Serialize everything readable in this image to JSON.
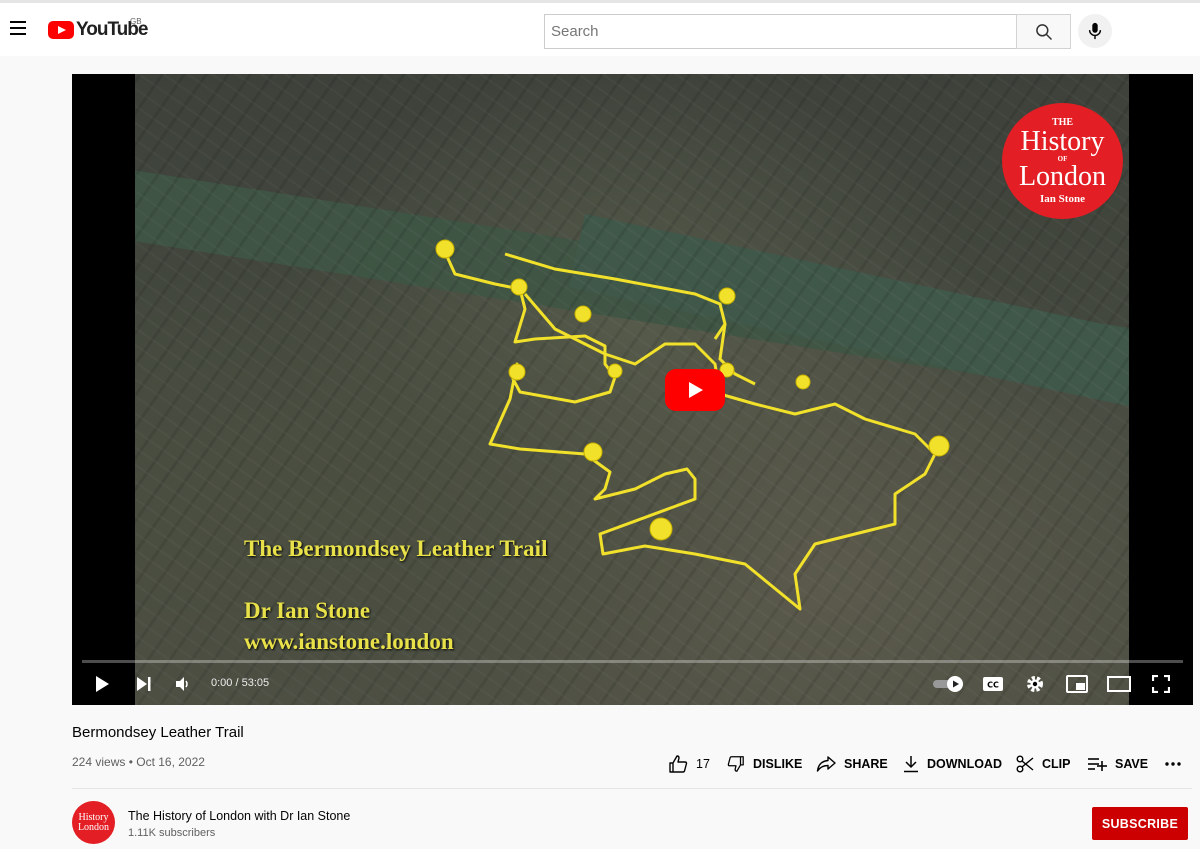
{
  "header": {
    "logo_text": "YouTube",
    "region": "GB",
    "search_placeholder": "Search"
  },
  "video": {
    "overlay_title": "The Bermondsey Leather Trail",
    "overlay_author": "Dr Ian Stone",
    "overlay_website": "www.ianstone.london",
    "badge": {
      "the": "THE",
      "history": "History",
      "of": "OF",
      "london": "London",
      "author": "Ian Stone"
    },
    "time_display": "0:00 / 53:05",
    "progress_fraction": 0.0
  },
  "details": {
    "title": "Bermondsey Leather Trail",
    "meta": "224 views • Oct 16, 2022",
    "actions": {
      "like_count": "17",
      "dislike": "DISLIKE",
      "share": "SHARE",
      "download": "DOWNLOAD",
      "clip": "CLIP",
      "save": "SAVE"
    }
  },
  "channel": {
    "name": "The History of London with Dr Ian Stone",
    "subscribers": "1.11K subscribers",
    "subscribe_label": "SUBSCRIBE",
    "avatar_line1": "History",
    "avatar_line2": "London"
  },
  "colors": {
    "brand_red": "#ff0000",
    "subscribe_red": "#cc0000",
    "route_yellow": "#f2e12a"
  }
}
